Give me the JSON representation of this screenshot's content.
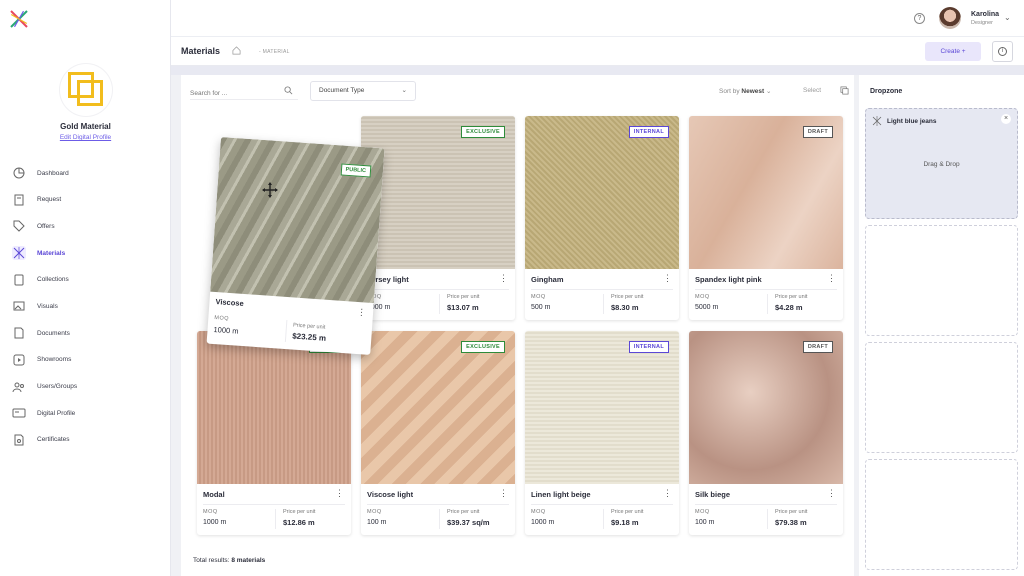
{
  "profile": {
    "name": "Gold Material",
    "edit_label": "Edit Digital Profile"
  },
  "nav": [
    {
      "label": "Dashboard",
      "icon": "pie-chart-icon"
    },
    {
      "label": "Request",
      "icon": "clipboard-icon"
    },
    {
      "label": "Offers",
      "icon": "tag-icon"
    },
    {
      "label": "Materials",
      "icon": "materials-icon",
      "active": true
    },
    {
      "label": "Collections",
      "icon": "book-icon"
    },
    {
      "label": "Visuals",
      "icon": "image-icon"
    },
    {
      "label": "Documents",
      "icon": "document-icon"
    },
    {
      "label": "Showrooms",
      "icon": "play-icon"
    },
    {
      "label": "Users/Groups",
      "icon": "users-icon"
    },
    {
      "label": "Digital Profile",
      "icon": "id-card-icon"
    },
    {
      "label": "Certificates",
      "icon": "certificate-icon"
    }
  ],
  "user": {
    "name": "Karolina",
    "role": "Designer"
  },
  "header": {
    "title": "Materials",
    "breadcrumb": "MATERIAL",
    "create_label": "Create +"
  },
  "toolbar": {
    "search_placeholder": "Search for ...",
    "doc_type": "Document Type",
    "sort_prefix": "Sort by",
    "sort_value": "Newest",
    "select_label": "Select"
  },
  "materials": [
    {
      "name": "Jersey light",
      "badge": "EXCLUSIVE",
      "moq_label": "MOQ",
      "moq": "1000 m",
      "price_label": "Price per unit",
      "price": "$13.07 m"
    },
    {
      "name": "Gingham",
      "badge": "INTERNAL",
      "moq_label": "MOQ",
      "moq": "500 m",
      "price_label": "Price per unit",
      "price": "$8.30 m"
    },
    {
      "name": "Spandex light pink",
      "badge": "DRAFT",
      "moq_label": "MOQ",
      "moq": "5000 m",
      "price_label": "Price per unit",
      "price": "$4.28 m"
    },
    {
      "name": "Modal",
      "badge": "PUBLIC",
      "moq_label": "MOQ",
      "moq": "1000 m",
      "price_label": "Price per unit",
      "price": "$12.86 m"
    },
    {
      "name": "Viscose light",
      "badge": "EXCLUSIVE",
      "moq_label": "MOQ",
      "moq": "100 m",
      "price_label": "Price per unit",
      "price": "$39.37 sq/m"
    },
    {
      "name": "Linen light beige",
      "badge": "INTERNAL",
      "moq_label": "MOQ",
      "moq": "1000 m",
      "price_label": "Price per unit",
      "price": "$9.18 m"
    },
    {
      "name": "Silk biege",
      "badge": "DRAFT",
      "moq_label": "MOQ",
      "moq": "100 m",
      "price_label": "Price per unit",
      "price": "$79.38 m"
    }
  ],
  "dragged": {
    "name": "Viscose",
    "badge": "PUBLIC",
    "moq_label": "MOQ",
    "moq": "1000 m",
    "price_label": "Price per unit",
    "price": "$23.25 m"
  },
  "total": {
    "prefix": "Total results:",
    "value": "8 materials"
  },
  "dropzone": {
    "title": "Dropzone",
    "item": "Light blue jeans",
    "hint": "Drag & Drop"
  },
  "colors": {
    "accent": "#5b47d6",
    "gold": "#f2bd1d"
  }
}
